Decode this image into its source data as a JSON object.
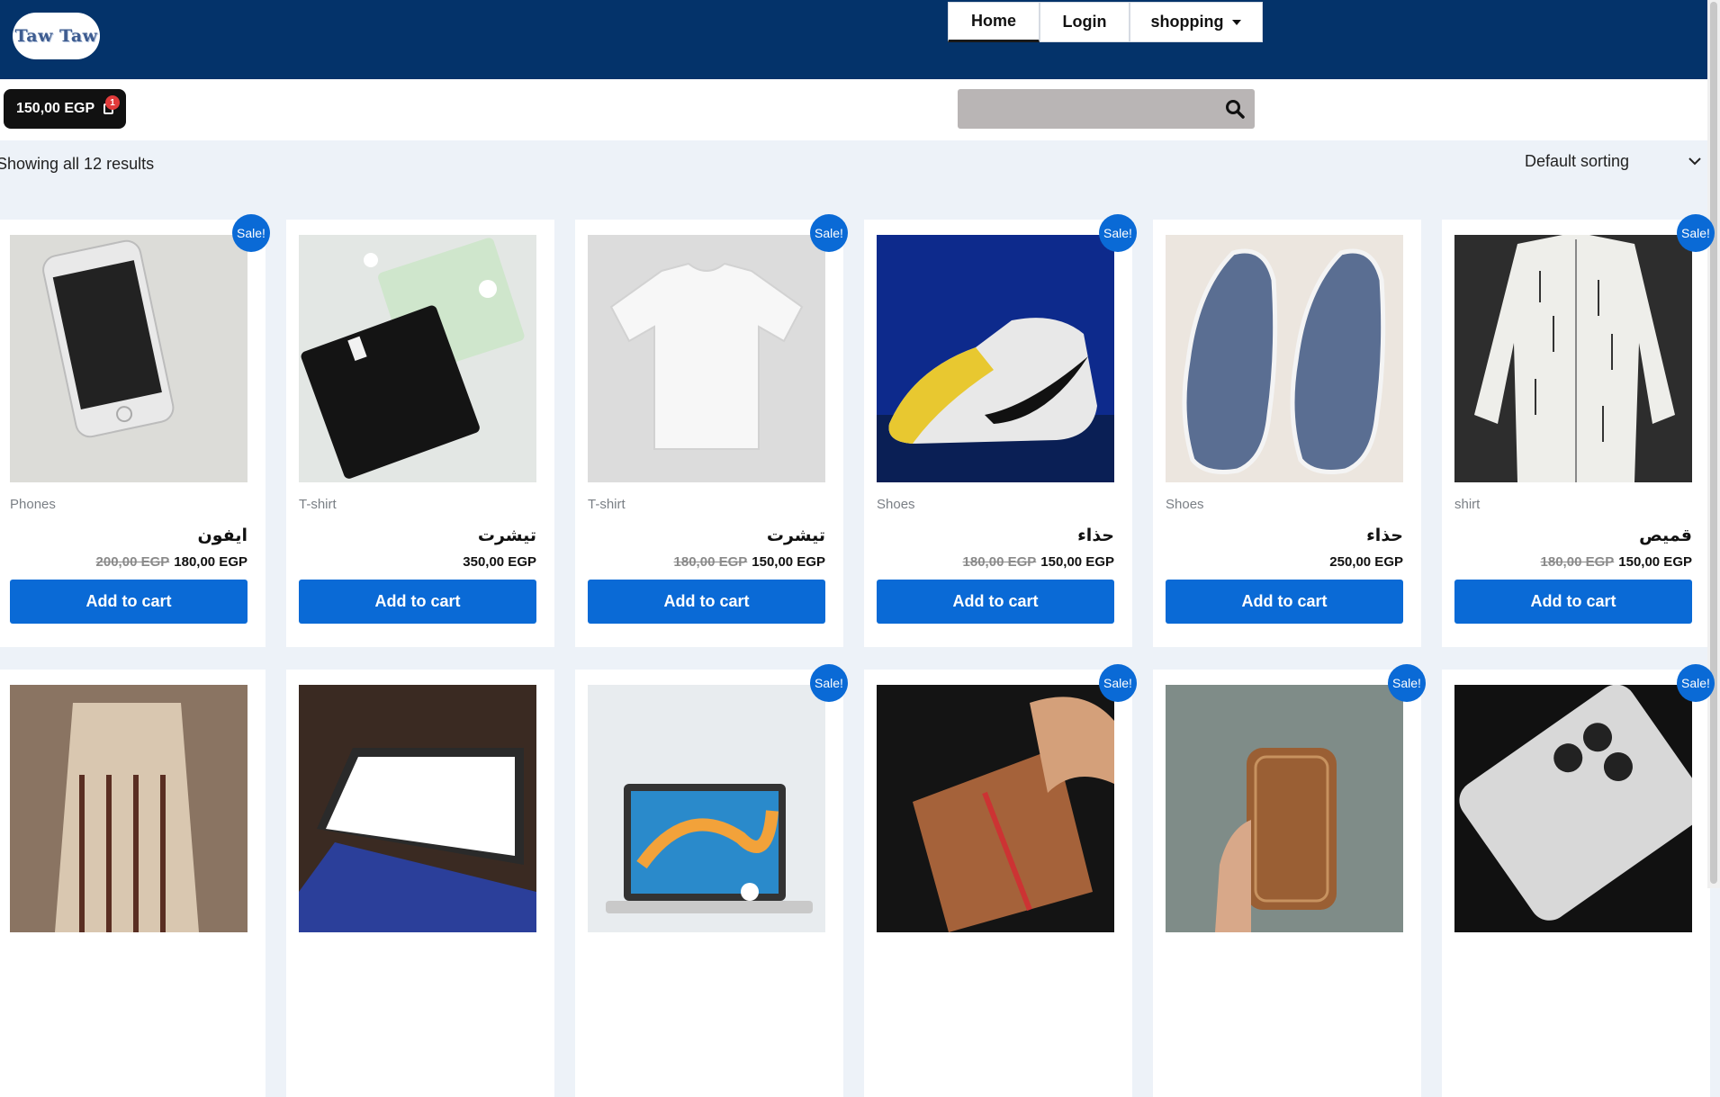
{
  "header": {
    "logo": "Taw Taw",
    "nav": {
      "home": "Home",
      "login": "Login",
      "shopping": "shopping"
    }
  },
  "cart": {
    "total": "150,00 EGP",
    "count": "1"
  },
  "search": {
    "placeholder": ""
  },
  "shop": {
    "results": "Showing all 12 results",
    "sorting": "Default sorting"
  },
  "products": [
    {
      "sale": "Sale!",
      "category": "Phones",
      "title": "ايفون",
      "old_price": "200,00 EGP",
      "price": "180,00 EGP",
      "button": "Add to cart"
    },
    {
      "sale": "",
      "category": "T-shirt",
      "title": "تيشرت",
      "old_price": "",
      "price": "350,00 EGP",
      "button": "Add to cart"
    },
    {
      "sale": "Sale!",
      "category": "T-shirt",
      "title": "تيشرت",
      "old_price": "180,00 EGP",
      "price": "150,00 EGP",
      "button": "Add to cart"
    },
    {
      "sale": "Sale!",
      "category": "Shoes",
      "title": "حذاء",
      "old_price": "180,00 EGP",
      "price": "150,00 EGP",
      "button": "Add to cart"
    },
    {
      "sale": "",
      "category": "Shoes",
      "title": "حذاء",
      "old_price": "",
      "price": "250,00 EGP",
      "button": "Add to cart"
    },
    {
      "sale": "Sale!",
      "category": "shirt",
      "title": "قميص",
      "old_price": "180,00 EGP",
      "price": "150,00 EGP",
      "button": "Add to cart"
    },
    {
      "sale": ""
    },
    {
      "sale": ""
    },
    {
      "sale": "Sale!"
    },
    {
      "sale": "Sale!"
    },
    {
      "sale": "Sale!"
    },
    {
      "sale": "Sale!"
    }
  ],
  "colors": {
    "header": "#04336a",
    "accent": "#0a6ad6",
    "page_bg": "#edf2f8"
  }
}
